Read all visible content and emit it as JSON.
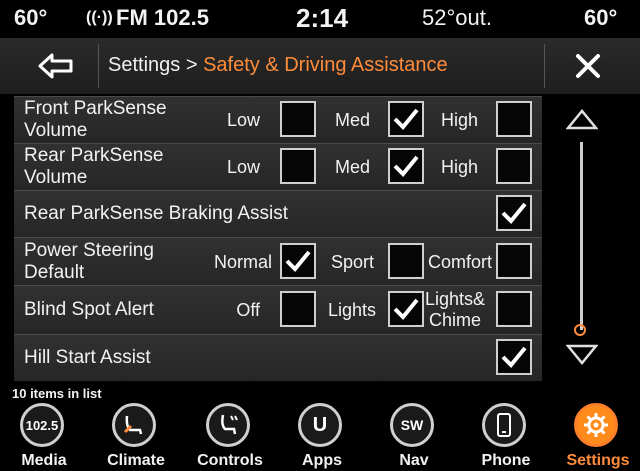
{
  "status": {
    "temp_left": "60°",
    "radio": "FM 102.5",
    "time": "2:14",
    "outside": "52°out.",
    "temp_right": "60°"
  },
  "header": {
    "breadcrumb_root": "Settings >",
    "breadcrumb_current": "Safety & Driving Assistance"
  },
  "rows": [
    {
      "label_line1": "Front ParkSense",
      "label_line2": "Volume",
      "options": [
        {
          "label": "Low",
          "checked": false
        },
        {
          "label": "Med",
          "checked": true
        },
        {
          "label": "High",
          "checked": false
        }
      ]
    },
    {
      "label_line1": "Rear ParkSense",
      "label_line2": "Volume",
      "options": [
        {
          "label": "Low",
          "checked": false
        },
        {
          "label": "Med",
          "checked": true
        },
        {
          "label": "High",
          "checked": false
        }
      ]
    },
    {
      "label_line1": "Rear ParkSense Braking Assist",
      "checked": true
    },
    {
      "label_line1": "Power Steering",
      "label_line2": "Default",
      "options": [
        {
          "label": "Normal",
          "checked": true
        },
        {
          "label": "Sport",
          "checked": false
        },
        {
          "label": "Comfort",
          "checked": false
        }
      ]
    },
    {
      "label_line1": "Blind Spot Alert",
      "options": [
        {
          "label": "Off",
          "checked": false
        },
        {
          "label": "Lights",
          "checked": true
        },
        {
          "label_line1": "Lights&",
          "label_line2": "Chime",
          "checked": false
        }
      ]
    },
    {
      "label_line1": "Hill Start Assist",
      "checked": true
    }
  ],
  "list_count": "10 items in list",
  "nav": [
    {
      "label": "Media",
      "icon_text": "102.5",
      "active": false
    },
    {
      "label": "Climate",
      "icon": "climate-seat-icon",
      "active": false
    },
    {
      "label": "Controls",
      "icon": "seat-controls-icon",
      "active": false
    },
    {
      "label": "Apps",
      "icon_text": "U",
      "active": false
    },
    {
      "label": "Nav",
      "icon_text": "SW",
      "active": false
    },
    {
      "label": "Phone",
      "icon": "phone-icon",
      "active": false
    },
    {
      "label": "Settings",
      "icon": "gear-icon",
      "active": true
    }
  ],
  "colors": {
    "accent": "#ff8c3a",
    "background": "#000000",
    "row": "#2c2c2c"
  }
}
